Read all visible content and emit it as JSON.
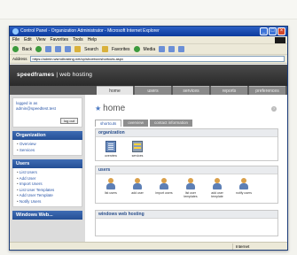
{
  "window": {
    "title": "Control Panel - Organization Administrator - Microsoft Internet Explorer",
    "menu": [
      "File",
      "Edit",
      "View",
      "Favorites",
      "Tools",
      "Help"
    ],
    "toolbar": {
      "back_label": "Back",
      "search_label": "Search",
      "favorites_label": "Favorites",
      "media_label": "Media"
    },
    "address_label": "Address",
    "address_value": "https://admin.wsmdhosting.net/cp/shoebox/shortcuts.aspx",
    "status_zone": "Internet"
  },
  "banner": {
    "brand_bold": "speedframes",
    "brand_rest": " | web hosting"
  },
  "tabs": [
    "home",
    "users",
    "services",
    "reports",
    "preferences"
  ],
  "login": {
    "text_line1": "logged in as",
    "text_line2": "admin@speedtest.test",
    "logout_label": "log out"
  },
  "sidebar": {
    "organization": {
      "title": "Organization",
      "items": [
        "Overview",
        "Services"
      ]
    },
    "users": {
      "title": "Users",
      "items": [
        "List Users",
        "Add User",
        "Import Users",
        "List User Templates",
        "Add User Template",
        "Notify Users"
      ]
    },
    "windows": {
      "title": "Windows Web..."
    }
  },
  "main": {
    "title": "home",
    "subtabs": [
      "shortcuts",
      "overview",
      "contact information"
    ],
    "panels": {
      "organization": {
        "title": "organization",
        "items": [
          "overview",
          "services"
        ]
      },
      "users": {
        "title": "users",
        "items": [
          "list users",
          "add user",
          "import users",
          "list user templates",
          "add user template",
          "notify users"
        ]
      },
      "windows": {
        "title": "windows web hosting"
      }
    }
  }
}
